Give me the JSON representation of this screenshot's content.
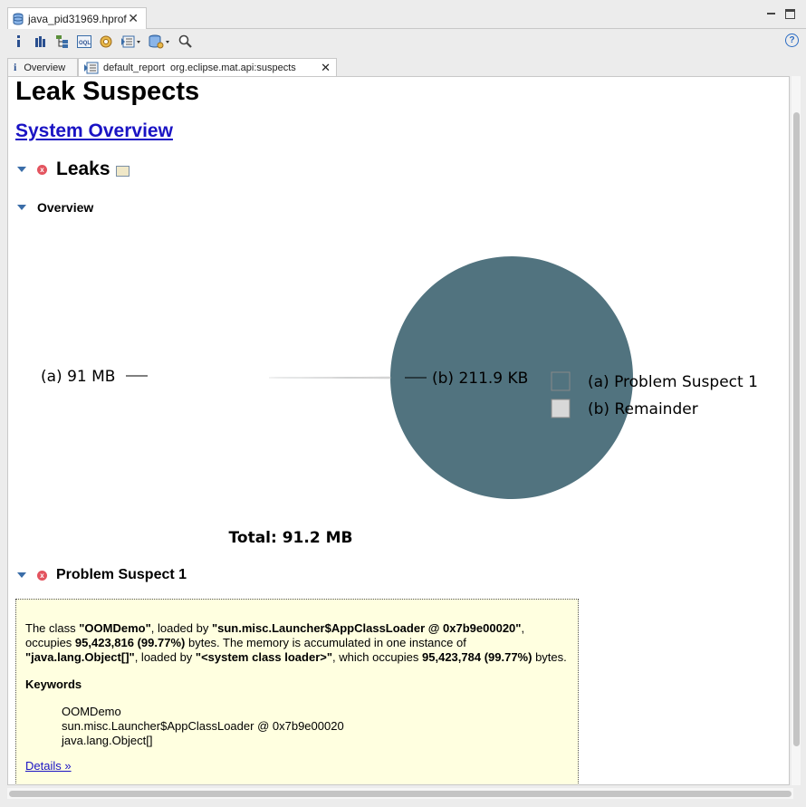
{
  "editor_tab": {
    "title": "java_pid31969.hprof"
  },
  "inner_tabs": [
    {
      "label": "Overview"
    },
    {
      "label": "default_report  org.eclipse.mat.api:suspects"
    }
  ],
  "page": {
    "title": "Leak Suspects",
    "system_overview_link": "System Overview",
    "leaks_label": "Leaks",
    "overview_label": "Overview",
    "problem_label": "Problem Suspect 1"
  },
  "chart_data": {
    "type": "pie",
    "slices": [
      {
        "label": "(a)",
        "value_label": "91 MB",
        "value_mb": 91.0,
        "legend": "Problem Suspect 1",
        "color": "#51737f"
      },
      {
        "label": "(b)",
        "value_label": "211.9 KB",
        "value_mb": 0.2069,
        "legend": "Remainder",
        "color": "#d8d8d8"
      }
    ],
    "total_label": "Total: 91.2 MB"
  },
  "suspect": {
    "description_parts": [
      {
        "text": "The class ",
        "bold": false
      },
      {
        "text": "\"OOMDemo\"",
        "bold": true
      },
      {
        "text": ", loaded by ",
        "bold": false
      },
      {
        "text": "\"sun.misc.Launcher$AppClassLoader @ 0x7b9e00020\"",
        "bold": true
      },
      {
        "text": ", occupies ",
        "bold": false
      },
      {
        "text": "95,423,816 (99.77%)",
        "bold": true
      },
      {
        "text": " bytes. The memory is accumulated in one instance of ",
        "bold": false
      },
      {
        "text": "\"java.lang.Object[]\"",
        "bold": true
      },
      {
        "text": ", loaded by ",
        "bold": false
      },
      {
        "text": "\"<system class loader>\"",
        "bold": true
      },
      {
        "text": ", which occupies ",
        "bold": false
      },
      {
        "text": "95,423,784 (99.77%)",
        "bold": true
      },
      {
        "text": " bytes.",
        "bold": false
      }
    ],
    "keywords_title": "Keywords",
    "keywords": [
      "OOMDemo",
      "sun.misc.Launcher$AppClassLoader @ 0x7b9e00020",
      "java.lang.Object[]"
    ],
    "details_link": "Details »"
  },
  "toolbar": {
    "icons": [
      "info-icon",
      "histogram-icon",
      "dominator-tree-icon",
      "oql-icon",
      "thread-overview-icon",
      "run-report-icon",
      "query-browser-icon",
      "search-icon"
    ]
  },
  "colors": {
    "link": "#1a13c4",
    "box_bg": "#ffffe0",
    "accent": "#3a6da8"
  }
}
